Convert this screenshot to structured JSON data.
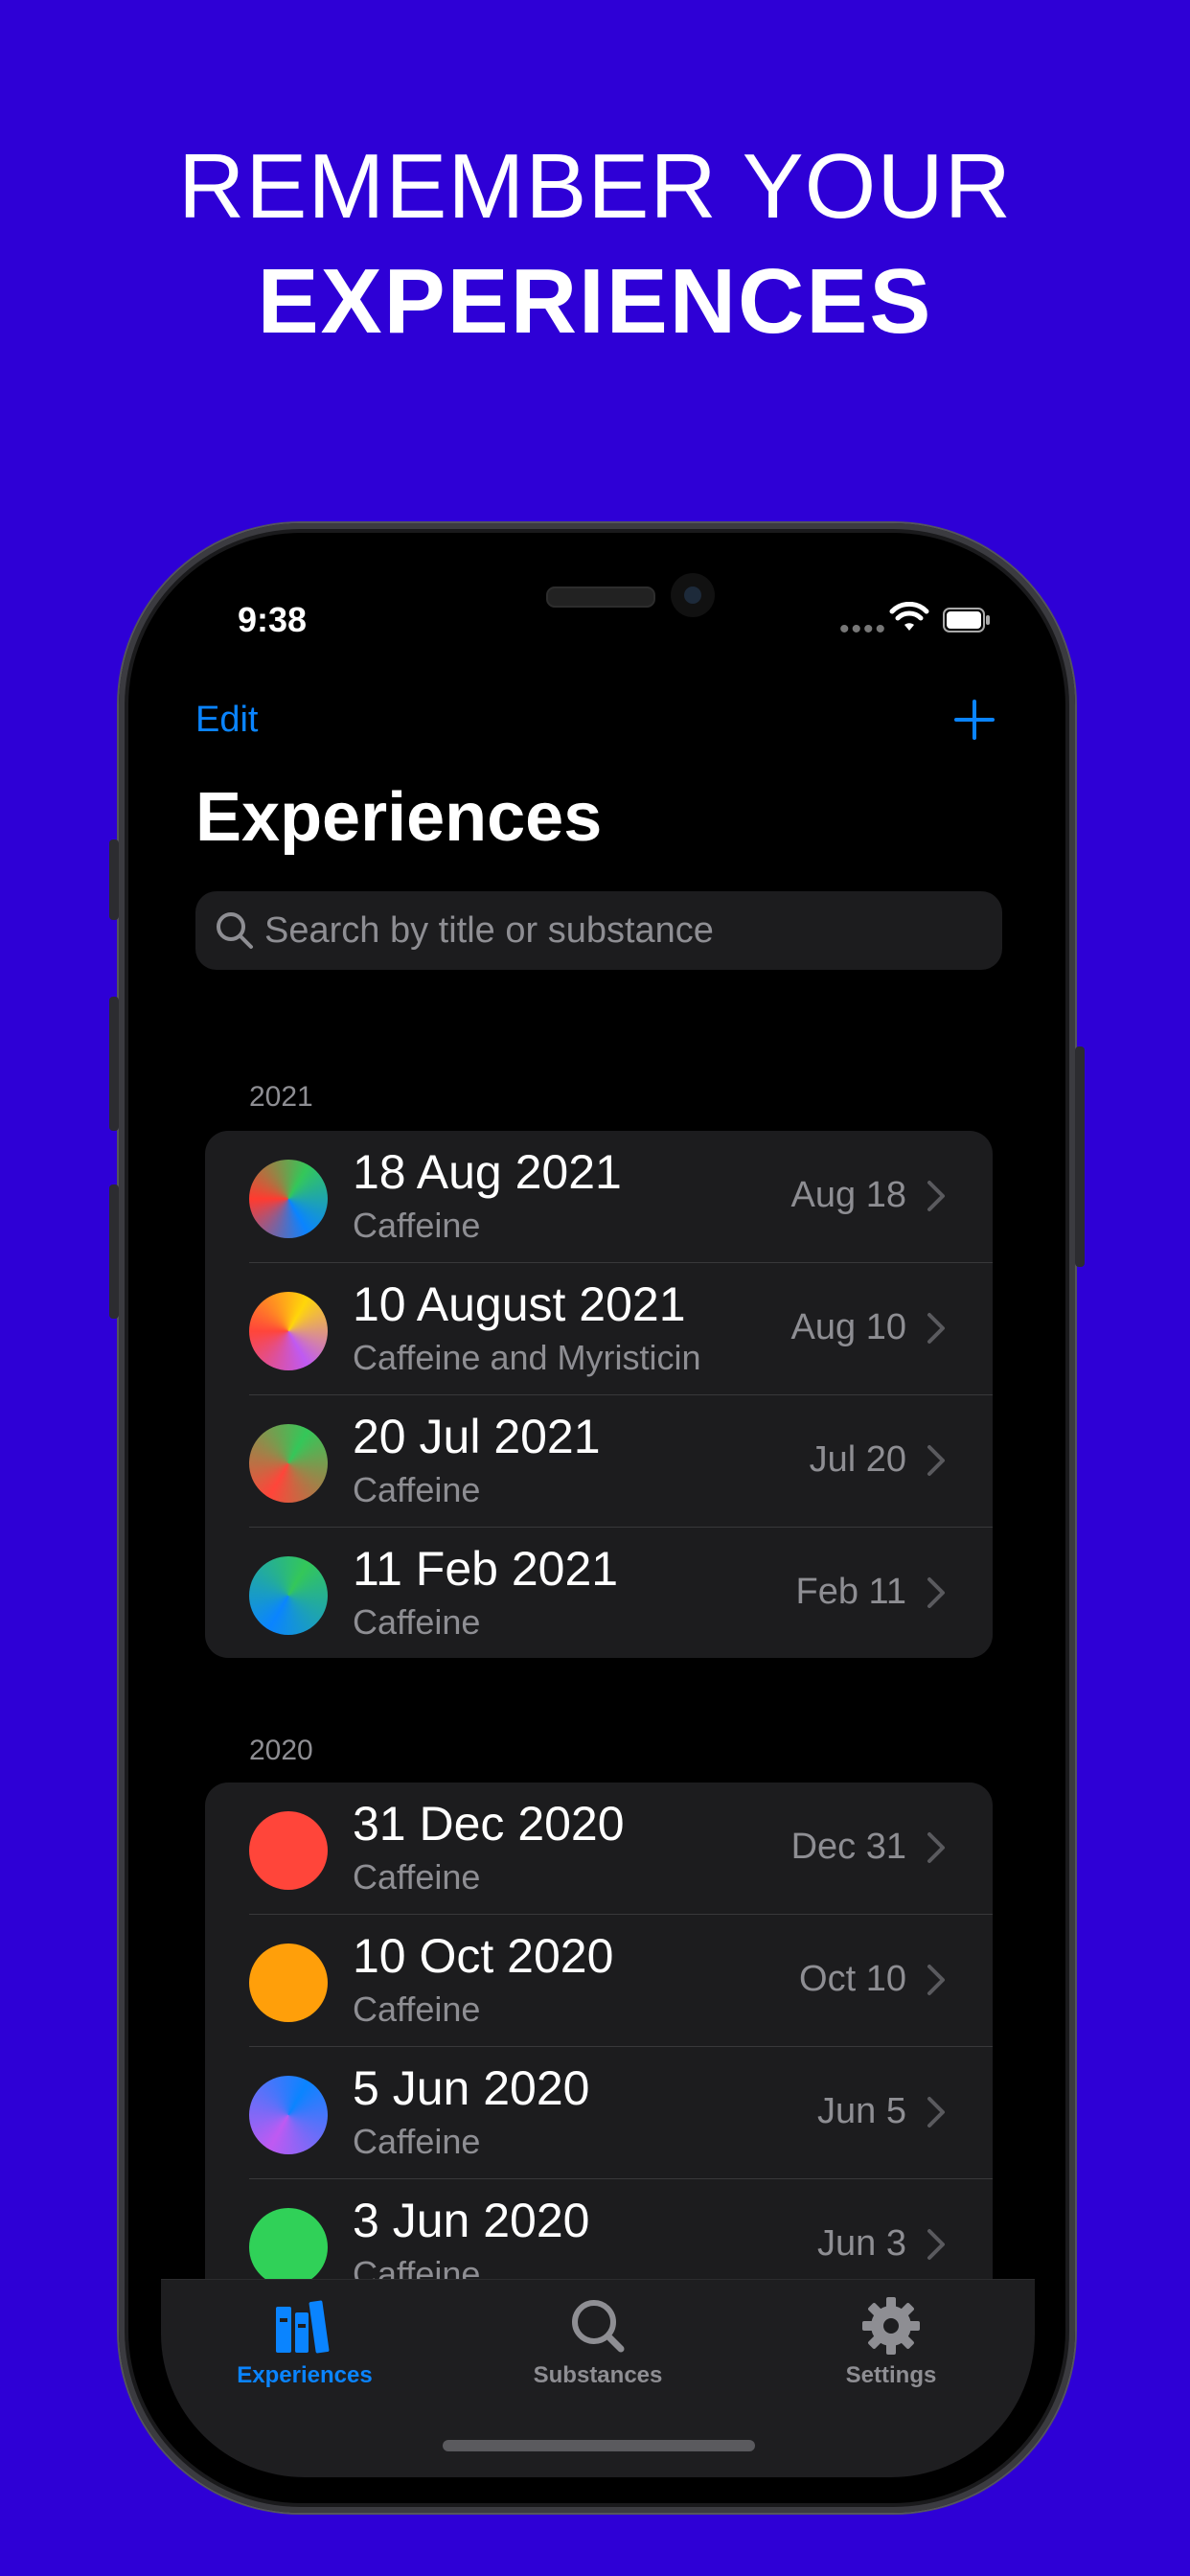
{
  "headline": {
    "line1": "REMEMBER YOUR",
    "line2": "EXPERIENCES"
  },
  "status_bar": {
    "time": "9:38"
  },
  "nav": {
    "edit_label": "Edit",
    "add_icon": "plus-icon"
  },
  "page_title": "Experiences",
  "search": {
    "placeholder": "Search by title or substance"
  },
  "sections": [
    {
      "header": "2021",
      "rows": [
        {
          "title": "18 Aug 2021",
          "subtitle": "Caffeine",
          "date": "Aug 18",
          "colors": [
            "#34C759",
            "#0A84FF",
            "#FF3B30"
          ]
        },
        {
          "title": "10 August 2021",
          "subtitle": "Caffeine and Myristicin",
          "date": "Aug 10",
          "colors": [
            "#FFD60A",
            "#BF5AF2",
            "#FF453A"
          ]
        },
        {
          "title": "20 Jul 2021",
          "subtitle": "Caffeine",
          "date": "Jul 20",
          "colors": [
            "#34C759",
            "#FF453A"
          ]
        },
        {
          "title": "11 Feb 2021",
          "subtitle": "Caffeine",
          "date": "Feb 11",
          "colors": [
            "#34C759",
            "#0A84FF"
          ]
        }
      ]
    },
    {
      "header": "2020",
      "rows": [
        {
          "title": "31 Dec 2020",
          "subtitle": "Caffeine",
          "date": "Dec 31",
          "colors": [
            "#FF453A"
          ]
        },
        {
          "title": "10 Oct 2020",
          "subtitle": "Caffeine",
          "date": "Oct 10",
          "colors": [
            "#FF9F0A"
          ]
        },
        {
          "title": "5 Jun 2020",
          "subtitle": "Caffeine",
          "date": "Jun 5",
          "colors": [
            "#0A84FF",
            "#BF5AF2"
          ]
        },
        {
          "title": "3 Jun 2020",
          "subtitle": "Caffeine",
          "date": "Jun 3",
          "colors": [
            "#30D158"
          ]
        }
      ]
    }
  ],
  "tabs": [
    {
      "label": "Experiences",
      "icon": "books-icon",
      "active": true
    },
    {
      "label": "Substances",
      "icon": "magnifier-icon",
      "active": false
    },
    {
      "label": "Settings",
      "icon": "gear-icon",
      "active": false
    }
  ],
  "colors": {
    "accent": "#0A84FF",
    "background": "#2E00D6",
    "inactive_tab": "#8E8E93"
  }
}
